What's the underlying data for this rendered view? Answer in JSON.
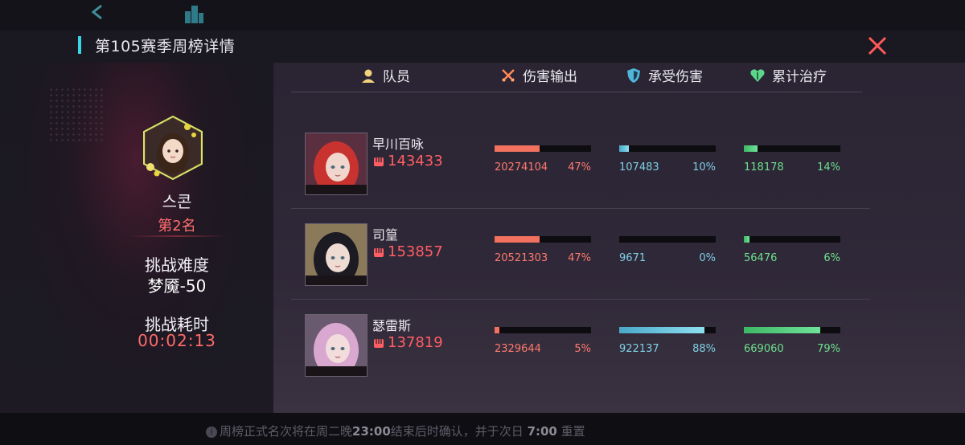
{
  "modal": {
    "title": "第105赛季周榜详情",
    "close_icon": "close-x-icon"
  },
  "player": {
    "name": "스콘",
    "rank": "第2名",
    "difficulty_label": "挑战难度",
    "difficulty_value": "梦魇-50",
    "time_label": "挑战耗时",
    "time_value": "00:02:13"
  },
  "table": {
    "headers": {
      "member": "队员",
      "damage": "伤害输出",
      "taken": "承受伤害",
      "heal": "累计治疗"
    },
    "members": [
      {
        "name": "早川百咏",
        "power": "143433",
        "damage": {
          "value": "20274104",
          "pct": "47%",
          "fill": 0.47
        },
        "taken": {
          "value": "107483",
          "pct": "10%",
          "fill": 0.1
        },
        "heal": {
          "value": "118178",
          "pct": "14%",
          "fill": 0.14
        },
        "hair": "#c8322f",
        "skin": "#f0d6cc",
        "bg": "#5a3040"
      },
      {
        "name": "司篁",
        "power": "153857",
        "damage": {
          "value": "20521303",
          "pct": "47%",
          "fill": 0.47
        },
        "taken": {
          "value": "9671",
          "pct": "0%",
          "fill": 0.0
        },
        "heal": {
          "value": "56476",
          "pct": "6%",
          "fill": 0.06
        },
        "hair": "#1c1a22",
        "skin": "#eedcd2",
        "bg": "#8a7a5a"
      },
      {
        "name": "瑟雷斯",
        "power": "137819",
        "damage": {
          "value": "2329644",
          "pct": "5%",
          "fill": 0.05
        },
        "taken": {
          "value": "922137",
          "pct": "88%",
          "fill": 0.88
        },
        "heal": {
          "value": "669060",
          "pct": "79%",
          "fill": 0.79
        },
        "hair": "#d8a8d0",
        "skin": "#f2dcdc",
        "bg": "#6a5a70"
      }
    ]
  },
  "footer": {
    "notice_pre": "周榜正式名次将在周二晚",
    "notice_time1": "23:00",
    "notice_mid": "结束后时确认，并于次日",
    "notice_time2": "7:00",
    "notice_post": "重置"
  }
}
